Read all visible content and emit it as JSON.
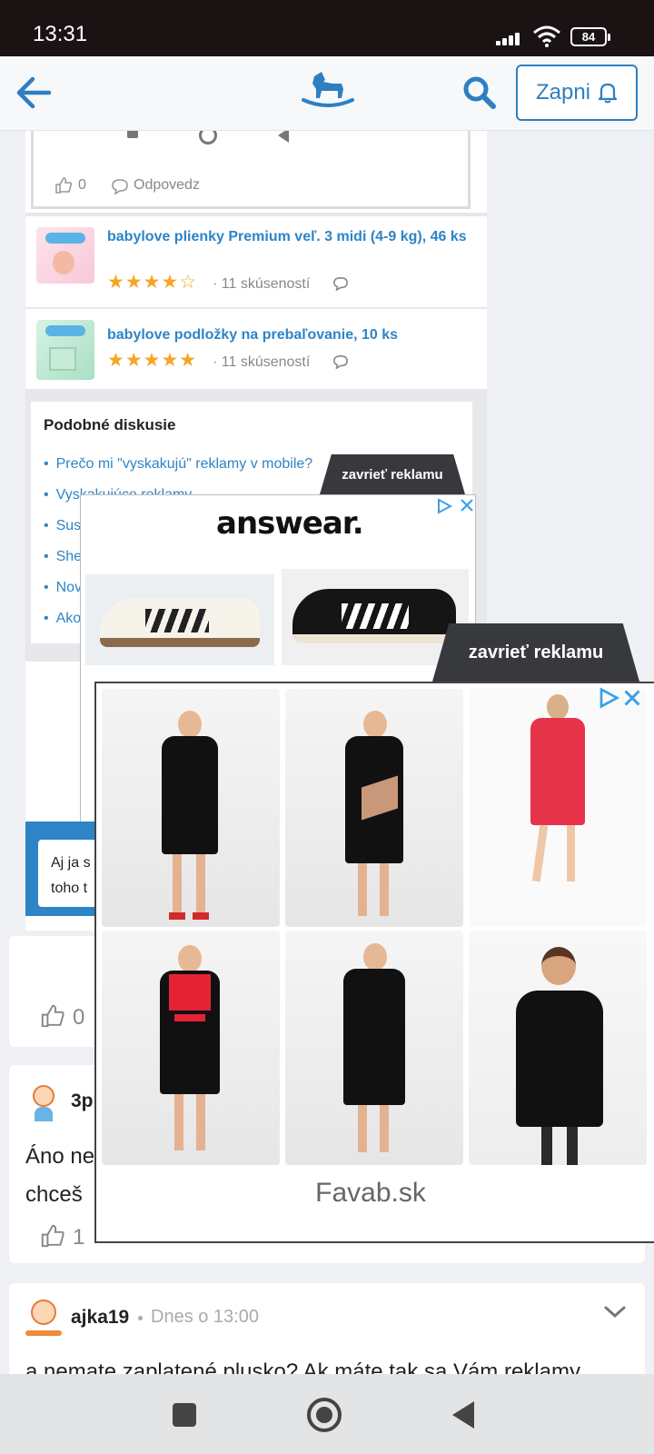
{
  "status_bar": {
    "time": "13:31",
    "battery": "84"
  },
  "header": {
    "subscribe_label": "Zapni"
  },
  "embedded": {
    "like_count": "0",
    "reply_label": "Odpovedz",
    "products": [
      {
        "title": "babylove plienky Premium veľ. 3 midi (4-9 kg), 46 ks",
        "rating": 4,
        "reviews": "· 11 skúseností"
      },
      {
        "title": "babylove podložky na prebaľovanie, 10 ks",
        "rating": 5,
        "reviews": "· 11 skúseností"
      }
    ],
    "similar_title": "Podobné diskusie",
    "similar_items": [
      "Prečo mi \"vyskakujú\" reklamy v mobile?",
      "Vyskakujúce reklamy",
      "Sus",
      "She",
      "Nov",
      "Ako"
    ],
    "comment_partial_1": "Aj ja s",
    "comment_partial_2": "toho t"
  },
  "ad1": {
    "close_label": "zavrieť reklamu",
    "brand": "answear."
  },
  "ad2": {
    "close_label": "zavrieť reklamu",
    "advertiser": "Favab.sk"
  },
  "posts": [
    {
      "likes": "0"
    },
    {
      "author_partial": "3p",
      "text_line1": "Áno ne",
      "text_line2": "chceš",
      "likes": "1"
    },
    {
      "author": "ajka19",
      "time": "Dnes o 13:00",
      "text": "a nemate zaplatené plusko? Ak máte tak sa Vám reklamy"
    }
  ],
  "colors": {
    "accent": "#2e7fc1",
    "status_bg": "#1b1214",
    "star": "#f5a623",
    "ad_tab": "#37393c"
  }
}
